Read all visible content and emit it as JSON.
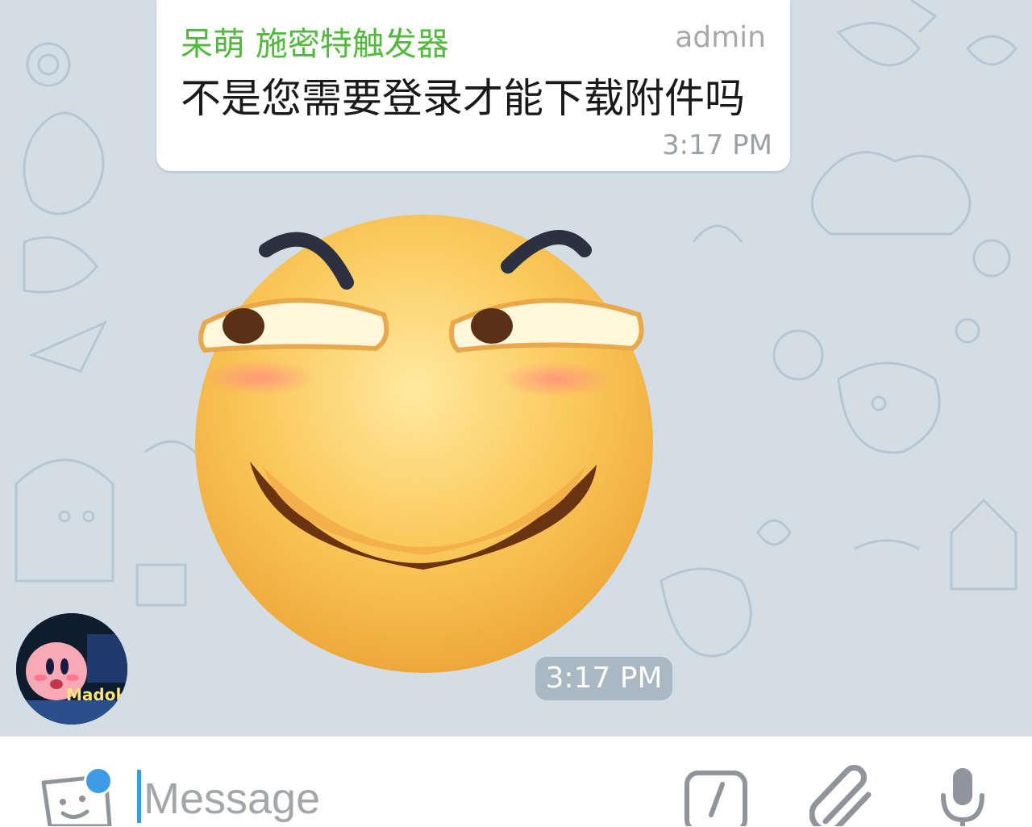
{
  "message": {
    "sender": "呆萌 施密特触发器",
    "role": "admin",
    "text": "不是您需要登录才能下载附件吗",
    "time": "3:17 PM"
  },
  "sticker": {
    "icon": "smirk-face-sticker",
    "time": "3:17 PM"
  },
  "avatar": {
    "icon": "user-avatar-kirby",
    "label": "Madok"
  },
  "input": {
    "placeholder": "Message",
    "value": ""
  },
  "toolbar": {
    "sticker_icon": "sticker-icon",
    "command_icon": "bot-command-icon",
    "attach_icon": "paperclip-icon",
    "mic_icon": "microphone-icon"
  },
  "colors": {
    "sender": "#52b83e",
    "accent": "#3f9be6",
    "chat_background": "#d2dde6"
  }
}
